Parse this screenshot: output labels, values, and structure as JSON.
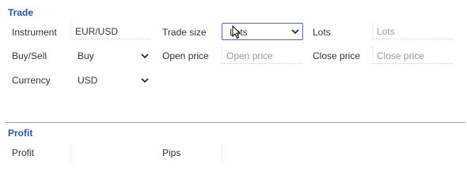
{
  "trade": {
    "title": "Trade",
    "instrument": {
      "label": "Instrument",
      "value": "EUR/USD"
    },
    "trade_size": {
      "label": "Trade size",
      "value": "Lots"
    },
    "lots": {
      "label": "Lots",
      "placeholder": "Lots"
    },
    "buy_sell": {
      "label": "Buy/Sell",
      "value": "Buy"
    },
    "open_price": {
      "label": "Open price",
      "placeholder": "Open price"
    },
    "close_price": {
      "label": "Close price",
      "placeholder": "Close price"
    },
    "currency": {
      "label": "Currency",
      "value": "USD"
    }
  },
  "profit": {
    "title": "Profit",
    "profit_label": "Profit",
    "pips_label": "Pips"
  },
  "icons": {
    "dropdown": "chevron-down-icon",
    "cursor": "mouse-cursor-icon"
  },
  "colors": {
    "section_title": "#2f5597",
    "focus_border": "#4a6da7"
  }
}
